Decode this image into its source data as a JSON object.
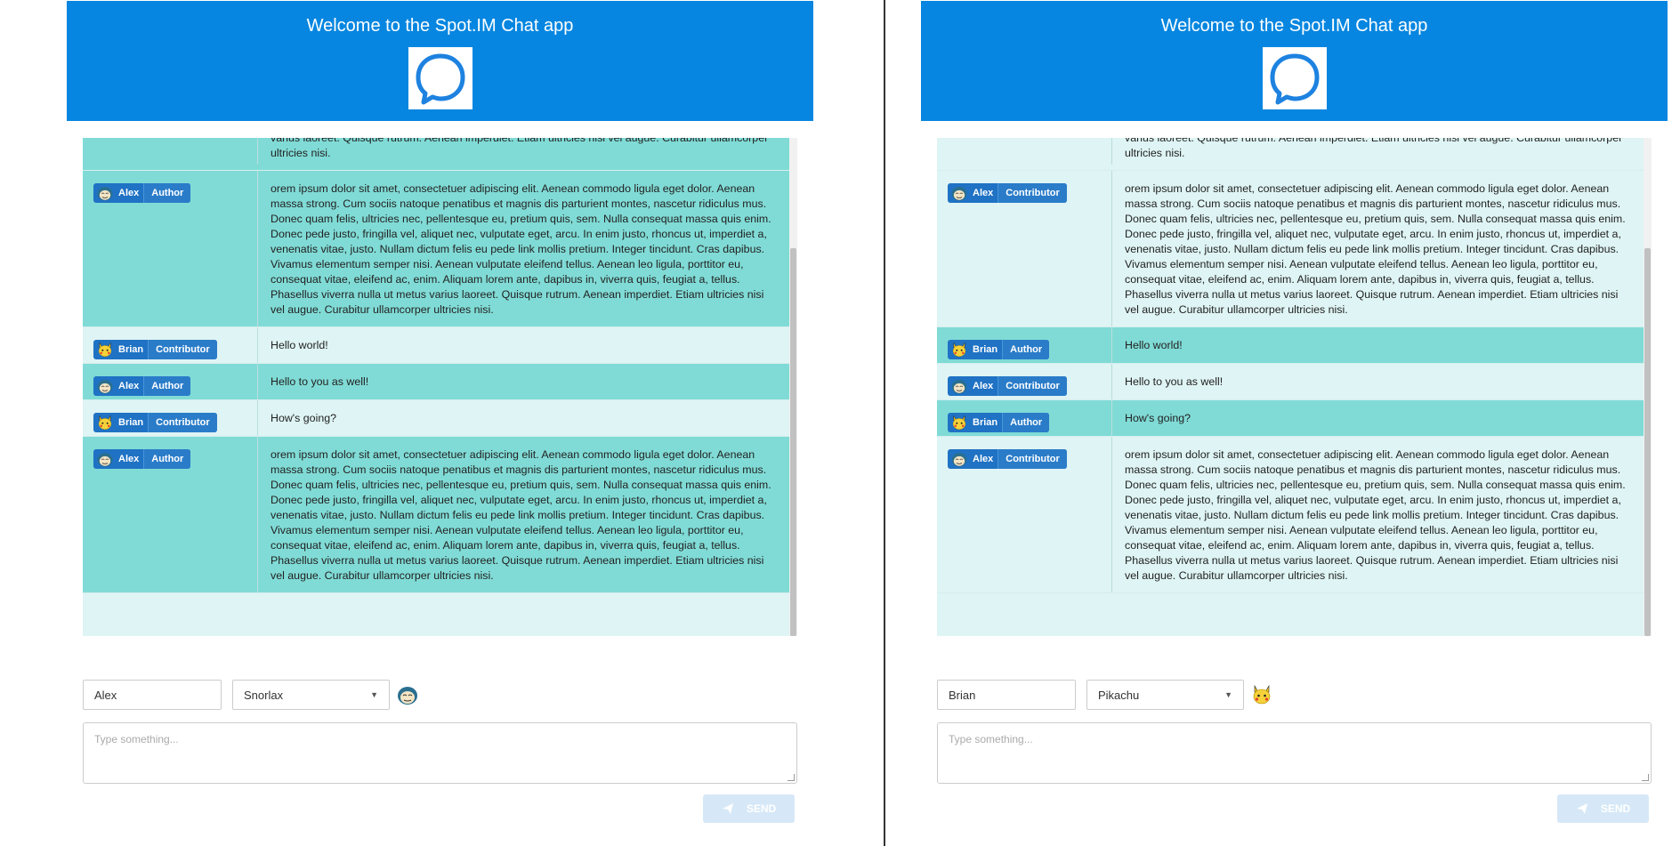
{
  "colors": {
    "header": "#0686e0",
    "dark_row": "#80dbd6",
    "light_row": "#dff4f4",
    "badge": "#1f72c4"
  },
  "app": {
    "title": "Welcome to the Spot.IM Chat app",
    "logo_icon": "chat-bubble-icon"
  },
  "lorem": "orem ipsum dolor sit amet, consectetuer adipiscing elit. Aenean commodo ligula eget dolor. Aenean massa strong. Cum sociis natoque penatibus et magnis dis parturient montes, nascetur ridiculus mus. Donec quam felis, ultricies nec, pellentesque eu, pretium quis, sem. Nulla consequat massa quis enim. Donec pede justo, fringilla vel, aliquet nec, vulputate eget, arcu. In enim justo, rhoncus ut, imperdiet a, venenatis vitae, justo. Nullam dictum felis eu pede link mollis pretium. Integer tincidunt. Cras dapibus. Vivamus elementum semper nisi. Aenean vulputate eleifend tellus. Aenean leo ligula, porttitor eu, consequat vitae, eleifend ac, enim. Aliquam lorem ante, dapibus in, viverra quis, feugiat a, tellus. Phasellus viverra nulla ut metus varius laoreet. Quisque rutrum. Aenean imperdiet. Etiam ultricies nisi vel augue. Curabitur ullamcorper ultricies nisi.",
  "left": {
    "partial_top": "varius laoreet. Quisque rutrum. Aenean imperdiet. Etiam ultricies nisi vel augue. Curabitur ullamcorper ultricies nisi.",
    "messages": [
      {
        "name": "Alex",
        "role": "Author",
        "avatar": "snorlax",
        "text": "orem ipsum dolor sit amet, consectetuer adipiscing elit. Aenean commodo ligula eget dolor. Aenean massa strong. Cum sociis natoque penatibus et magnis dis parturient montes, nascetur ridiculus mus. Donec quam felis, ultricies nec, pellentesque eu, pretium quis, sem. Nulla consequat massa quis enim. Donec pede justo, fringilla vel, aliquet nec, vulputate eget, arcu. In enim justo, rhoncus ut, imperdiet a, venenatis vitae, justo. Nullam dictum felis eu pede link mollis pretium. Integer tincidunt. Cras dapibus. Vivamus elementum semper nisi. Aenean vulputate eleifend tellus. Aenean leo ligula, porttitor eu, consequat vitae, eleifend ac, enim. Aliquam lorem ante, dapibus in, viverra quis, feugiat a, tellus. Phasellus viverra nulla ut metus varius laoreet. Quisque rutrum. Aenean imperdiet. Etiam ultricies nisi vel augue. Curabitur ullamcorper ultricies nisi."
      },
      {
        "name": "Brian",
        "role": "Contributor",
        "avatar": "pikachu",
        "text": "Hello world!"
      },
      {
        "name": "Alex",
        "role": "Author",
        "avatar": "snorlax",
        "text": "Hello to you as well!"
      },
      {
        "name": "Brian",
        "role": "Contributor",
        "avatar": "pikachu",
        "text": "How's going?"
      },
      {
        "name": "Alex",
        "role": "Author",
        "avatar": "snorlax",
        "text": "orem ipsum dolor sit amet, consectetuer adipiscing elit. Aenean commodo ligula eget dolor. Aenean massa strong. Cum sociis natoque penatibus et magnis dis parturient montes, nascetur ridiculus mus. Donec quam felis, ultricies nec, pellentesque eu, pretium quis, sem. Nulla consequat massa quis enim. Donec pede justo, fringilla vel, aliquet nec, vulputate eget, arcu. In enim justo, rhoncus ut, imperdiet a, venenatis vitae, justo. Nullam dictum felis eu pede link mollis pretium. Integer tincidunt. Cras dapibus. Vivamus elementum semper nisi. Aenean vulputate eleifend tellus. Aenean leo ligula, porttitor eu, consequat vitae, eleifend ac, enim. Aliquam lorem ante, dapibus in, viverra quis, feugiat a, tellus. Phasellus viverra nulla ut metus varius laoreet. Quisque rutrum. Aenean imperdiet. Etiam ultricies nisi vel augue. Curabitur ullamcorper ultricies nisi."
      }
    ],
    "composer": {
      "name": "Alex",
      "avatar_choice": "Snorlax",
      "placeholder": "Type something...",
      "send_label": "SEND"
    }
  },
  "right": {
    "partial_top": "varius laoreet. Quisque rutrum. Aenean imperdiet. Etiam ultricies nisi vel augue. Curabitur ullamcorper ultricies nisi.",
    "messages": [
      {
        "name": "Alex",
        "role": "Contributor",
        "avatar": "snorlax",
        "text": "orem ipsum dolor sit amet, consectetuer adipiscing elit. Aenean commodo ligula eget dolor. Aenean massa strong. Cum sociis natoque penatibus et magnis dis parturient montes, nascetur ridiculus mus. Donec quam felis, ultricies nec, pellentesque eu, pretium quis, sem. Nulla consequat massa quis enim. Donec pede justo, fringilla vel, aliquet nec, vulputate eget, arcu. In enim justo, rhoncus ut, imperdiet a, venenatis vitae, justo. Nullam dictum felis eu pede link mollis pretium. Integer tincidunt. Cras dapibus. Vivamus elementum semper nisi. Aenean vulputate eleifend tellus. Aenean leo ligula, porttitor eu, consequat vitae, eleifend ac, enim. Aliquam lorem ante, dapibus in, viverra quis, feugiat a, tellus. Phasellus viverra nulla ut metus varius laoreet. Quisque rutrum. Aenean imperdiet. Etiam ultricies nisi vel augue. Curabitur ullamcorper ultricies nisi."
      },
      {
        "name": "Brian",
        "role": "Author",
        "avatar": "pikachu",
        "text": "Hello world!"
      },
      {
        "name": "Alex",
        "role": "Contributor",
        "avatar": "snorlax",
        "text": "Hello to you as well!"
      },
      {
        "name": "Brian",
        "role": "Author",
        "avatar": "pikachu",
        "text": "How's going?"
      },
      {
        "name": "Alex",
        "role": "Contributor",
        "avatar": "snorlax",
        "text": "orem ipsum dolor sit amet, consectetuer adipiscing elit. Aenean commodo ligula eget dolor. Aenean massa strong. Cum sociis natoque penatibus et magnis dis parturient montes, nascetur ridiculus mus. Donec quam felis, ultricies nec, pellentesque eu, pretium quis, sem. Nulla consequat massa quis enim. Donec pede justo, fringilla vel, aliquet nec, vulputate eget, arcu. In enim justo, rhoncus ut, imperdiet a, venenatis vitae, justo. Nullam dictum felis eu pede link mollis pretium. Integer tincidunt. Cras dapibus. Vivamus elementum semper nisi. Aenean vulputate eleifend tellus. Aenean leo ligula, porttitor eu, consequat vitae, eleifend ac, enim. Aliquam lorem ante, dapibus in, viverra quis, feugiat a, tellus. Phasellus viverra nulla ut metus varius laoreet. Quisque rutrum. Aenean imperdiet. Etiam ultricies nisi vel augue. Curabitur ullamcorper ultricies nisi."
      }
    ],
    "composer": {
      "name": "Brian",
      "avatar_choice": "Pikachu",
      "placeholder": "Type something...",
      "send_label": "SEND"
    }
  }
}
